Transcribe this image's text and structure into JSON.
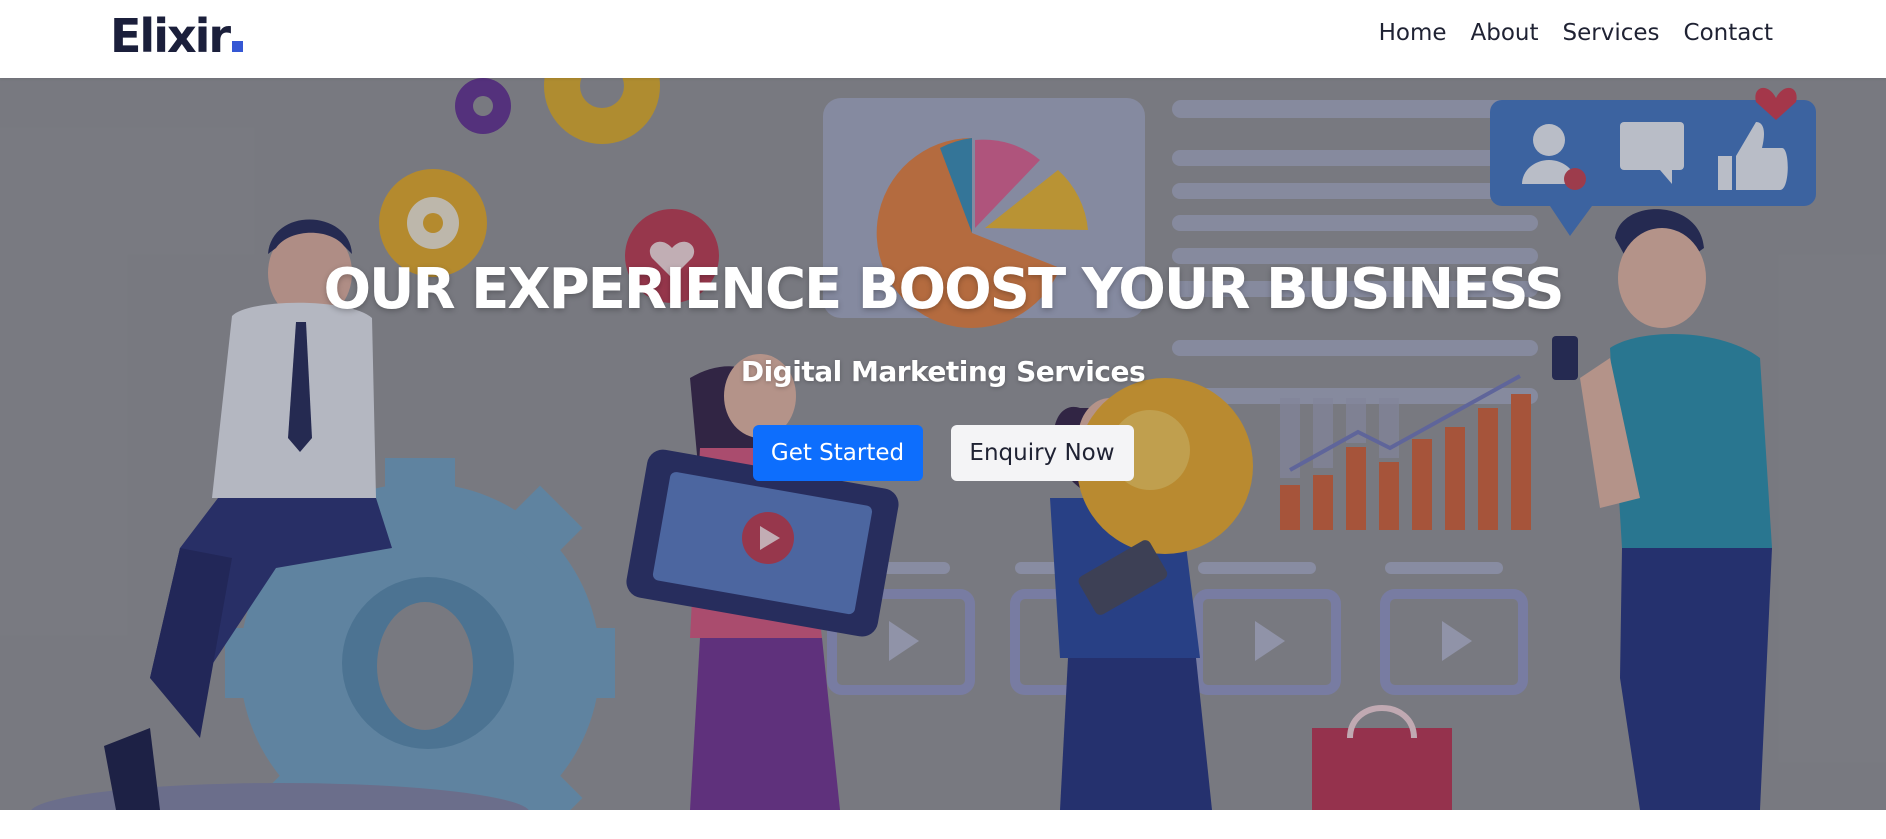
{
  "brand": {
    "name": "Elixir",
    "dot_color": "#3557d4",
    "text_color": "#1b1f3b"
  },
  "nav": {
    "items": [
      {
        "label": "Home"
      },
      {
        "label": "About"
      },
      {
        "label": "Services"
      },
      {
        "label": "Contact"
      }
    ]
  },
  "hero": {
    "title": "OUR EXPERIENCE BOOST YOUR BUSINESS",
    "subtitle": "Digital Marketing Services",
    "primary_button": "Get Started",
    "secondary_button": "Enquiry Now",
    "primary_color": "#0d6efd",
    "background_illustration": "digital-marketing-team-illustration"
  }
}
